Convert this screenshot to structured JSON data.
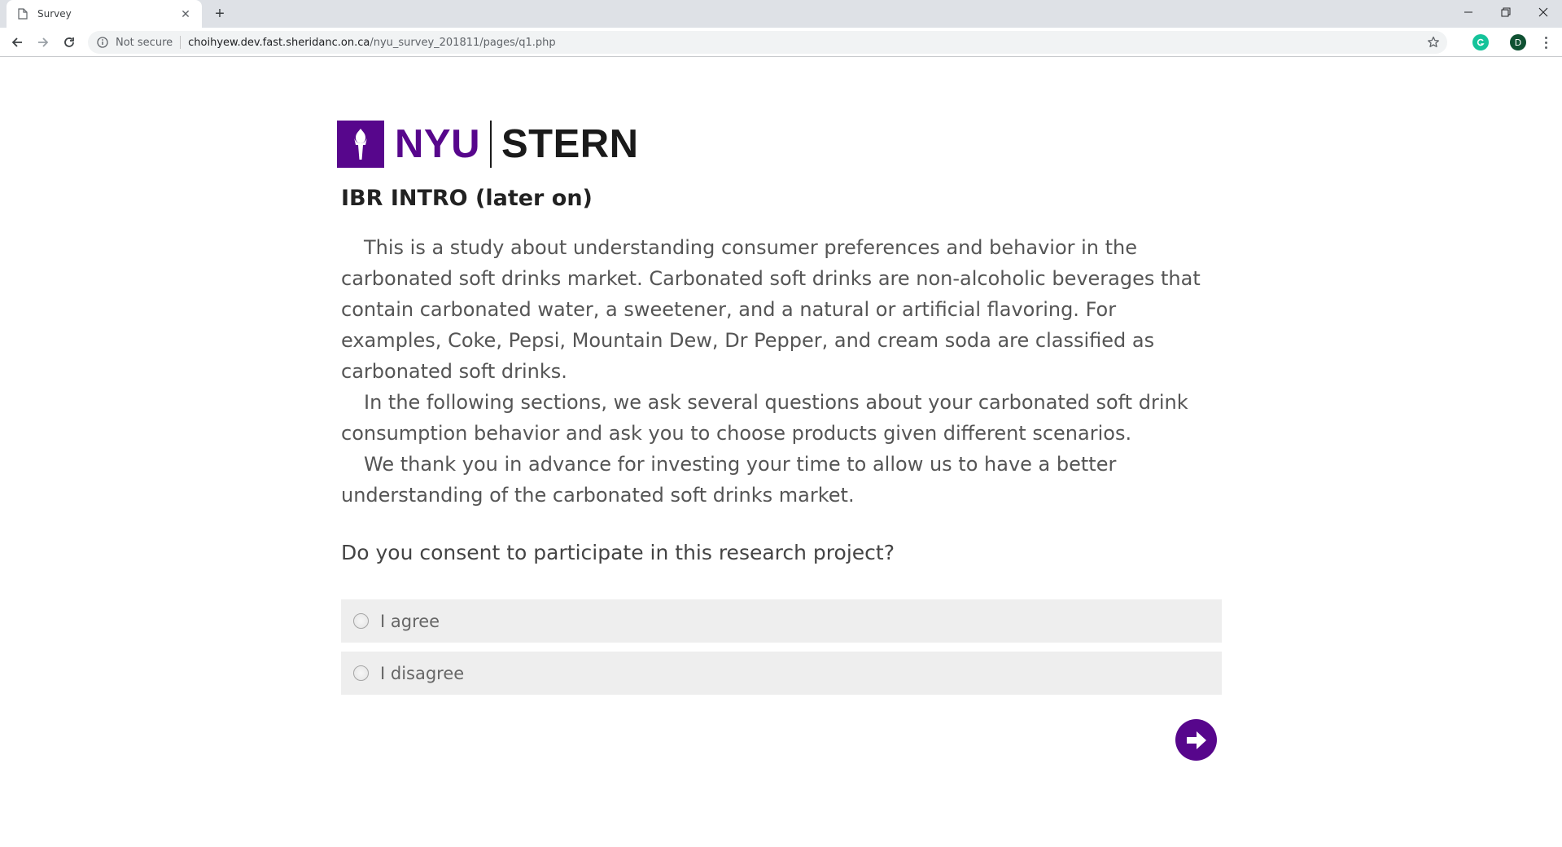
{
  "browser": {
    "tab_title": "Survey",
    "new_tab_symbol": "+",
    "close_symbol": "✕",
    "security_text": "Not secure",
    "url_host": "choihyew.dev.fast.sheridanc.on.ca",
    "url_path": "/nyu_survey_201811/pages/q1.php",
    "profile_initial": "D"
  },
  "logo": {
    "left": "NYU",
    "right": "STERN",
    "brand_color": "#57068c"
  },
  "page": {
    "title": "IBR INTRO (later on)",
    "paragraphs": [
      "This is a study about understanding consumer preferences and behavior in the carbonated soft drinks market. Carbonated soft drinks are non-alcoholic beverages that contain carbonated water, a sweetener, and a natural or artificial flavoring. For examples, Coke, Pepsi, Mountain Dew, Dr Pepper, and cream soda are classified as carbonated soft drinks.",
      "In the following sections, we ask several questions about your carbonated soft drink consumption behavior and ask you to choose products given different scenarios.",
      "We thank you in advance for investing your time to allow us to have a better understanding of the carbonated soft drinks market."
    ],
    "question": "Do you consent to participate in this research project?",
    "options": [
      "I agree",
      "I disagree"
    ]
  },
  "icons": {
    "favicon": "page-icon",
    "back": "arrow-left-icon",
    "forward": "arrow-right-icon",
    "reload": "reload-icon",
    "info": "info-icon",
    "bookmark": "star-icon",
    "grammarly": "grammarly-extension-icon",
    "menu": "more-vert-icon",
    "next": "arrow-right-circle-icon"
  }
}
